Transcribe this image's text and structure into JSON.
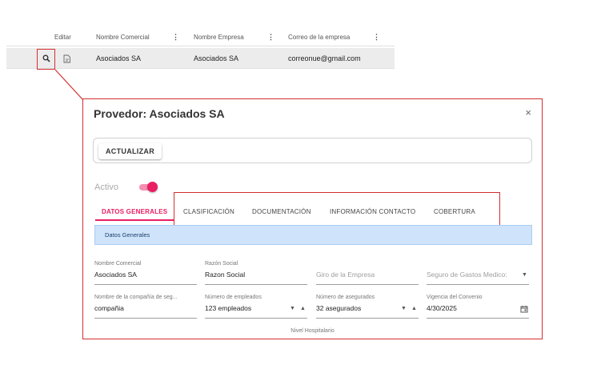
{
  "grid": {
    "columns": [
      "Editar",
      "Nombre Comercial",
      "Nombre Empresa",
      "Correo de la empresa"
    ],
    "menu_glyph": "⋮",
    "row": {
      "view_icon": "search-icon",
      "edit_icon": "edit-document-icon",
      "nombre_comercial": "Asociados SA",
      "nombre_empresa": "Asociados SA",
      "correo": "correonue@gmail.com"
    }
  },
  "dialog": {
    "title": "Provedor: Asociados SA",
    "close": "×",
    "update_button": "ACTUALIZAR",
    "active_label": "Activo",
    "active": true,
    "tabs": [
      "DATOS GENERALES",
      "CLASIFICACIÓN",
      "DOCUMENTACIÓN",
      "INFORMACIÓN CONTACTO",
      "COBERTURA"
    ],
    "active_tab": "DATOS GENERALES",
    "section_title": "Datos Generales",
    "fields": {
      "nombre_comercial": {
        "label": "Nombre Comercial",
        "value": "Asociados  SA"
      },
      "razon_social": {
        "label": "Razón Social",
        "value": "Razon Social"
      },
      "giro": {
        "placeholder": "Giro de la Empresa"
      },
      "seguro": {
        "placeholder": "Seguro de Gastos Medico:"
      },
      "compania": {
        "label": "Nombre de la compañía de seg...",
        "value": "compañia"
      },
      "empleados": {
        "label": "Número de empleados",
        "value": "123 empleados"
      },
      "asegurados": {
        "label": "Número de asegurados",
        "value": "32 asegurados"
      },
      "vigencia": {
        "label": "Vigencia del Convenio",
        "value": "4/30/2025"
      }
    },
    "nivel_label": "Nivel Hospitalario"
  },
  "colors": {
    "accent": "#e91e63",
    "highlight": "#d32f2f",
    "section_bg": "#cfe4fa"
  }
}
